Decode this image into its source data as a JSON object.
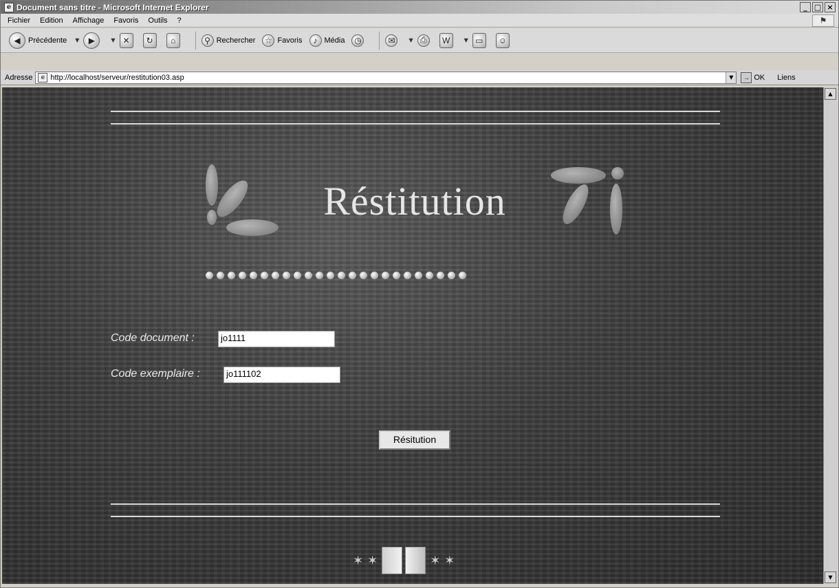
{
  "window": {
    "title": "Document sans titre - Microsoft Internet Explorer",
    "minimize": "_",
    "maximize": "□",
    "close": "×"
  },
  "menu": [
    "Fichier",
    "Edition",
    "Affichage",
    "Favoris",
    "Outils",
    "?"
  ],
  "toolbar": {
    "back": "Précédente",
    "search": "Rechercher",
    "favorites": "Favoris",
    "media": "Média"
  },
  "address": {
    "label": "Adresse",
    "url": "http://localhost/serveur/restitution03.asp",
    "go": "OK",
    "links": "Liens"
  },
  "page": {
    "heading": "Réstitution",
    "code_document_label": "Code document :",
    "code_document_value": "jo1111",
    "code_exemplaire_label": "Code exemplaire :",
    "code_exemplaire_value": "jo111102",
    "submit_label": "Résitution"
  }
}
